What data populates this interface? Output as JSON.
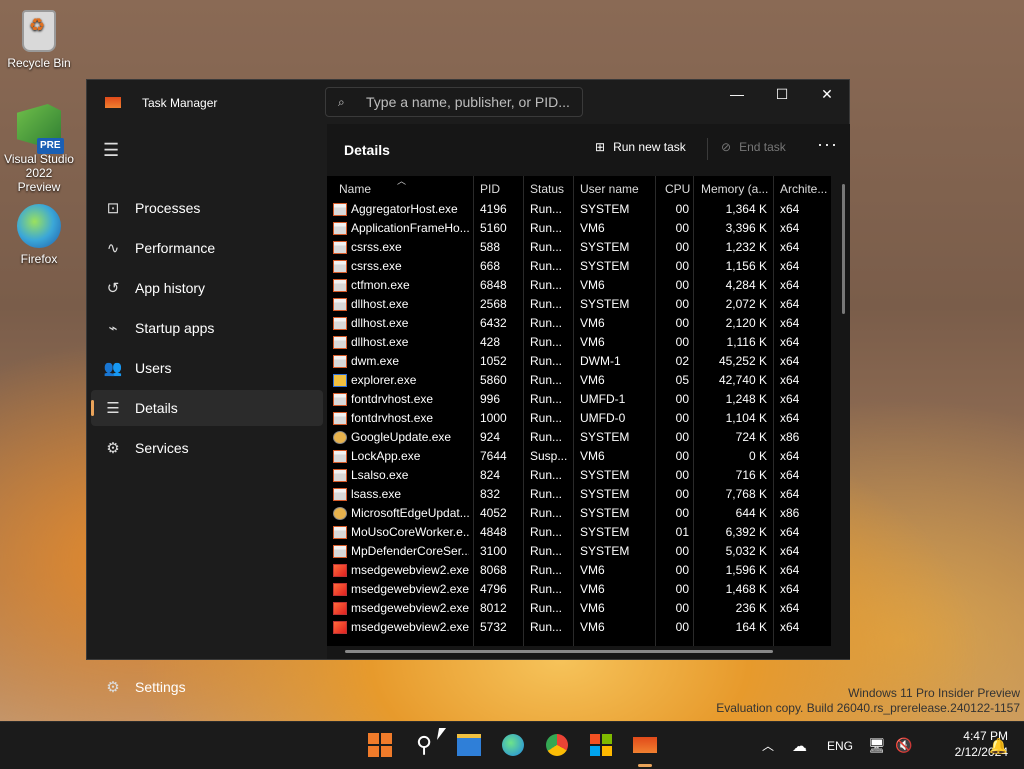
{
  "desktop": {
    "icons": [
      {
        "label": "Recycle Bin"
      },
      {
        "label": "Visual Studio 2022 Preview",
        "badge": "PRE"
      },
      {
        "label": "Firefox"
      }
    ],
    "watermark_line1": "Windows 11 Pro Insider Preview",
    "watermark_line2": "Evaluation copy. Build 26040.rs_prerelease.240122-1157"
  },
  "window": {
    "title": "Task Manager",
    "search_placeholder": "Type a name, publisher, or PID...",
    "controls": {
      "minimize": "—",
      "maximize": "☐",
      "close": "✕"
    }
  },
  "nav": {
    "items": [
      {
        "label": "Processes",
        "icon": "processes-icon",
        "glyph": "⊡"
      },
      {
        "label": "Performance",
        "icon": "performance-icon",
        "glyph": "∿"
      },
      {
        "label": "App history",
        "icon": "app-history-icon",
        "glyph": "↺"
      },
      {
        "label": "Startup apps",
        "icon": "startup-icon",
        "glyph": "⌁"
      },
      {
        "label": "Users",
        "icon": "users-icon",
        "glyph": "👥"
      },
      {
        "label": "Details",
        "icon": "details-icon",
        "glyph": "☰"
      },
      {
        "label": "Services",
        "icon": "services-icon",
        "glyph": "⚙"
      }
    ],
    "active": "Details",
    "settings_label": "Settings"
  },
  "details": {
    "title": "Details",
    "run_new_task": "Run new task",
    "end_task": "End task",
    "more": "···",
    "columns": [
      "Name",
      "PID",
      "Status",
      "User name",
      "CPU",
      "Memory (a...",
      "Archite..."
    ],
    "rows": [
      {
        "name": "AggregatorHost.exe",
        "pid": "4196",
        "status": "Run...",
        "user": "SYSTEM",
        "cpu": "00",
        "mem": "1,364 K",
        "arch": "x64",
        "icon": "default"
      },
      {
        "name": "ApplicationFrameHo...",
        "pid": "5160",
        "status": "Run...",
        "user": "VM6",
        "cpu": "00",
        "mem": "3,396 K",
        "arch": "x64",
        "icon": "default"
      },
      {
        "name": "csrss.exe",
        "pid": "588",
        "status": "Run...",
        "user": "SYSTEM",
        "cpu": "00",
        "mem": "1,232 K",
        "arch": "x64",
        "icon": "default"
      },
      {
        "name": "csrss.exe",
        "pid": "668",
        "status": "Run...",
        "user": "SYSTEM",
        "cpu": "00",
        "mem": "1,156 K",
        "arch": "x64",
        "icon": "default"
      },
      {
        "name": "ctfmon.exe",
        "pid": "6848",
        "status": "Run...",
        "user": "VM6",
        "cpu": "00",
        "mem": "4,284 K",
        "arch": "x64",
        "icon": "default"
      },
      {
        "name": "dllhost.exe",
        "pid": "2568",
        "status": "Run...",
        "user": "SYSTEM",
        "cpu": "00",
        "mem": "2,072 K",
        "arch": "x64",
        "icon": "default"
      },
      {
        "name": "dllhost.exe",
        "pid": "6432",
        "status": "Run...",
        "user": "VM6",
        "cpu": "00",
        "mem": "2,120 K",
        "arch": "x64",
        "icon": "default"
      },
      {
        "name": "dllhost.exe",
        "pid": "428",
        "status": "Run...",
        "user": "VM6",
        "cpu": "00",
        "mem": "1,116 K",
        "arch": "x64",
        "icon": "default"
      },
      {
        "name": "dwm.exe",
        "pid": "1052",
        "status": "Run...",
        "user": "DWM-1",
        "cpu": "02",
        "mem": "45,252 K",
        "arch": "x64",
        "icon": "default"
      },
      {
        "name": "explorer.exe",
        "pid": "5860",
        "status": "Run...",
        "user": "VM6",
        "cpu": "05",
        "mem": "42,740 K",
        "arch": "x64",
        "icon": "explorer"
      },
      {
        "name": "fontdrvhost.exe",
        "pid": "996",
        "status": "Run...",
        "user": "UMFD-1",
        "cpu": "00",
        "mem": "1,248 K",
        "arch": "x64",
        "icon": "default"
      },
      {
        "name": "fontdrvhost.exe",
        "pid": "1000",
        "status": "Run...",
        "user": "UMFD-0",
        "cpu": "00",
        "mem": "1,104 K",
        "arch": "x64",
        "icon": "default"
      },
      {
        "name": "GoogleUpdate.exe",
        "pid": "924",
        "status": "Run...",
        "user": "SYSTEM",
        "cpu": "00",
        "mem": "724 K",
        "arch": "x86",
        "icon": "google"
      },
      {
        "name": "LockApp.exe",
        "pid": "7644",
        "status": "Susp...",
        "user": "VM6",
        "cpu": "00",
        "mem": "0 K",
        "arch": "x64",
        "icon": "default"
      },
      {
        "name": "Lsalso.exe",
        "pid": "824",
        "status": "Run...",
        "user": "SYSTEM",
        "cpu": "00",
        "mem": "716 K",
        "arch": "x64",
        "icon": "default"
      },
      {
        "name": "lsass.exe",
        "pid": "832",
        "status": "Run...",
        "user": "SYSTEM",
        "cpu": "00",
        "mem": "7,768 K",
        "arch": "x64",
        "icon": "default"
      },
      {
        "name": "MicrosoftEdgeUpdat...",
        "pid": "4052",
        "status": "Run...",
        "user": "SYSTEM",
        "cpu": "00",
        "mem": "644 K",
        "arch": "x86",
        "icon": "google"
      },
      {
        "name": "MoUsoCoreWorker.e...",
        "pid": "4848",
        "status": "Run...",
        "user": "SYSTEM",
        "cpu": "01",
        "mem": "6,392 K",
        "arch": "x64",
        "icon": "default"
      },
      {
        "name": "MpDefenderCoreSer...",
        "pid": "3100",
        "status": "Run...",
        "user": "SYSTEM",
        "cpu": "00",
        "mem": "5,032 K",
        "arch": "x64",
        "icon": "default"
      },
      {
        "name": "msedgewebview2.exe",
        "pid": "8068",
        "status": "Run...",
        "user": "VM6",
        "cpu": "00",
        "mem": "1,596 K",
        "arch": "x64",
        "icon": "edge"
      },
      {
        "name": "msedgewebview2.exe",
        "pid": "4796",
        "status": "Run...",
        "user": "VM6",
        "cpu": "00",
        "mem": "1,468 K",
        "arch": "x64",
        "icon": "edge"
      },
      {
        "name": "msedgewebview2.exe",
        "pid": "8012",
        "status": "Run...",
        "user": "VM6",
        "cpu": "00",
        "mem": "236 K",
        "arch": "x64",
        "icon": "edge"
      },
      {
        "name": "msedgewebview2.exe",
        "pid": "5732",
        "status": "Run...",
        "user": "VM6",
        "cpu": "00",
        "mem": "164 K",
        "arch": "x64",
        "icon": "edge"
      }
    ]
  },
  "taskbar": {
    "language": "ENG",
    "time": "4:47 PM",
    "date": "2/12/2024",
    "accent": "#e9a35a"
  }
}
